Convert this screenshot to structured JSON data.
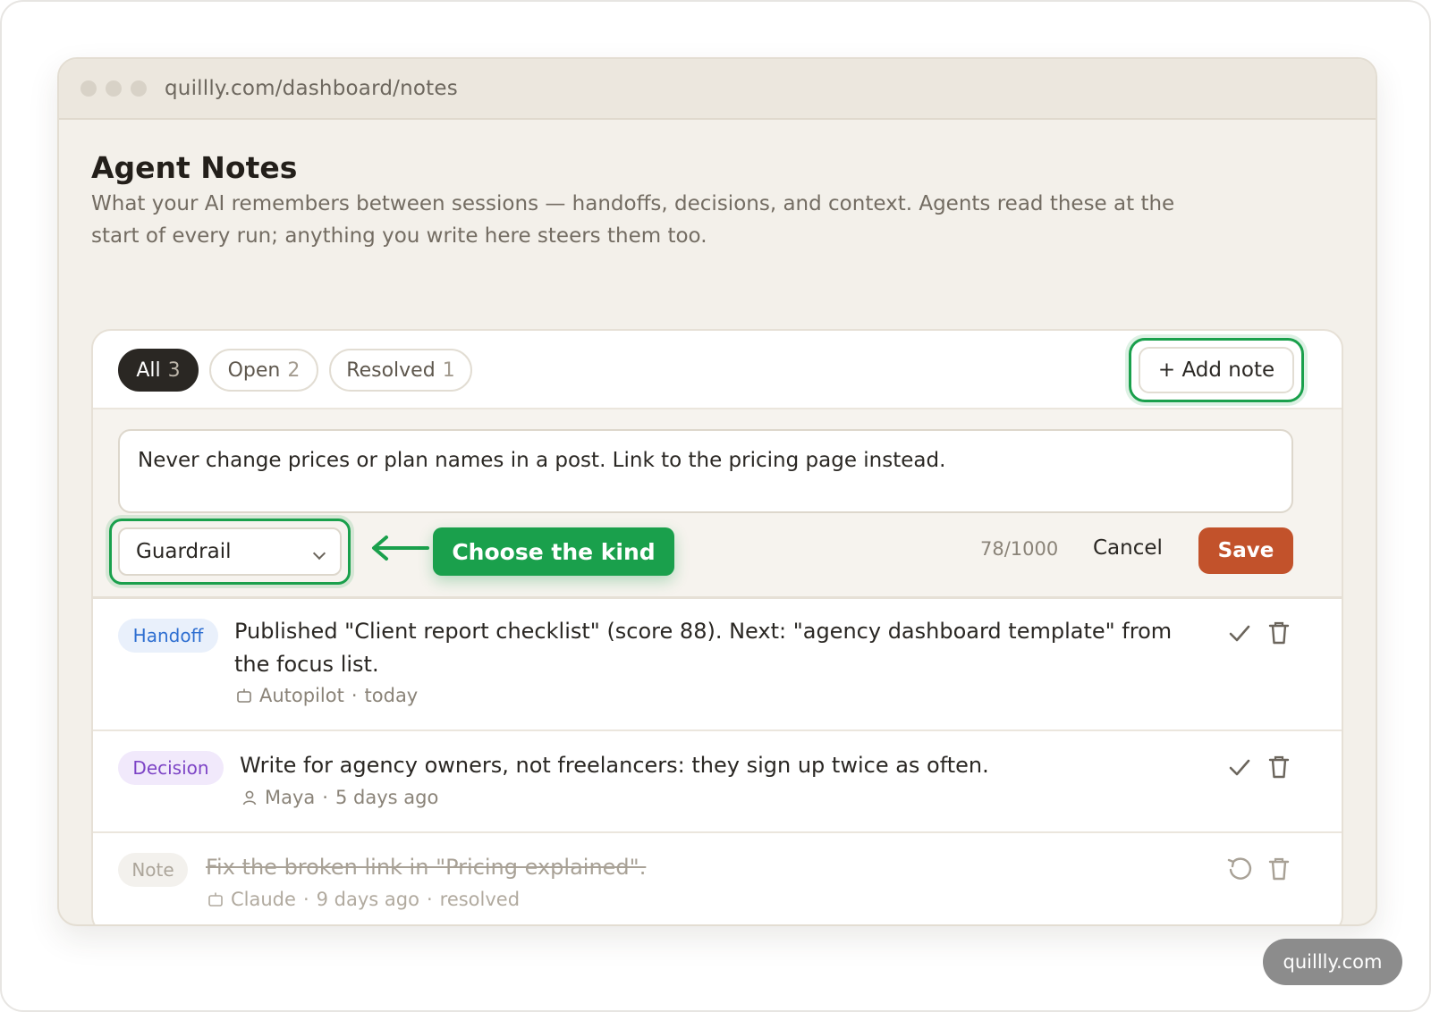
{
  "browser": {
    "url": "quillly.com/dashboard/notes"
  },
  "page": {
    "title": "Agent Notes",
    "subtitle": "What your AI remembers between sessions — handoffs, decisions, and context. Agents read these at the start of every run; anything you write here steers them too."
  },
  "tabs": [
    {
      "label": "All",
      "count": "3",
      "active": true
    },
    {
      "label": "Open",
      "count": "2",
      "active": false
    },
    {
      "label": "Resolved",
      "count": "1",
      "active": false
    }
  ],
  "toolbar": {
    "add_note_label": "+ Add note"
  },
  "composer": {
    "text": "Never change prices or plan names in a post. Link to the pricing page instead.",
    "kind_selected": "Guardrail",
    "callout": "Choose the kind",
    "counter": "78/1000",
    "cancel_label": "Cancel",
    "save_label": "Save"
  },
  "notes": [
    {
      "kind": "Handoff",
      "text": "Published \"Client report checklist\" (score 88). Next: \"agency dashboard template\" from the focus list.",
      "author_icon": "bot-icon",
      "author": "Autopilot",
      "time": "today",
      "status": "",
      "resolved": false
    },
    {
      "kind": "Decision",
      "text": "Write for agency owners, not freelancers: they sign up twice as often.",
      "author_icon": "person-icon",
      "author": "Maya",
      "time": "5 days ago",
      "status": "",
      "resolved": false
    },
    {
      "kind": "Note",
      "text": "Fix the broken link in \"Pricing explained\".",
      "author_icon": "bot-icon",
      "author": "Claude",
      "time": "9 days ago",
      "status": "resolved",
      "resolved": true
    }
  ],
  "watermark": "quillly.com",
  "colors": {
    "accent_green": "#1aa04c",
    "save_orange": "#c2522b",
    "handoff_blue": "#2f6fd1",
    "decision_purple": "#7d44c6"
  }
}
